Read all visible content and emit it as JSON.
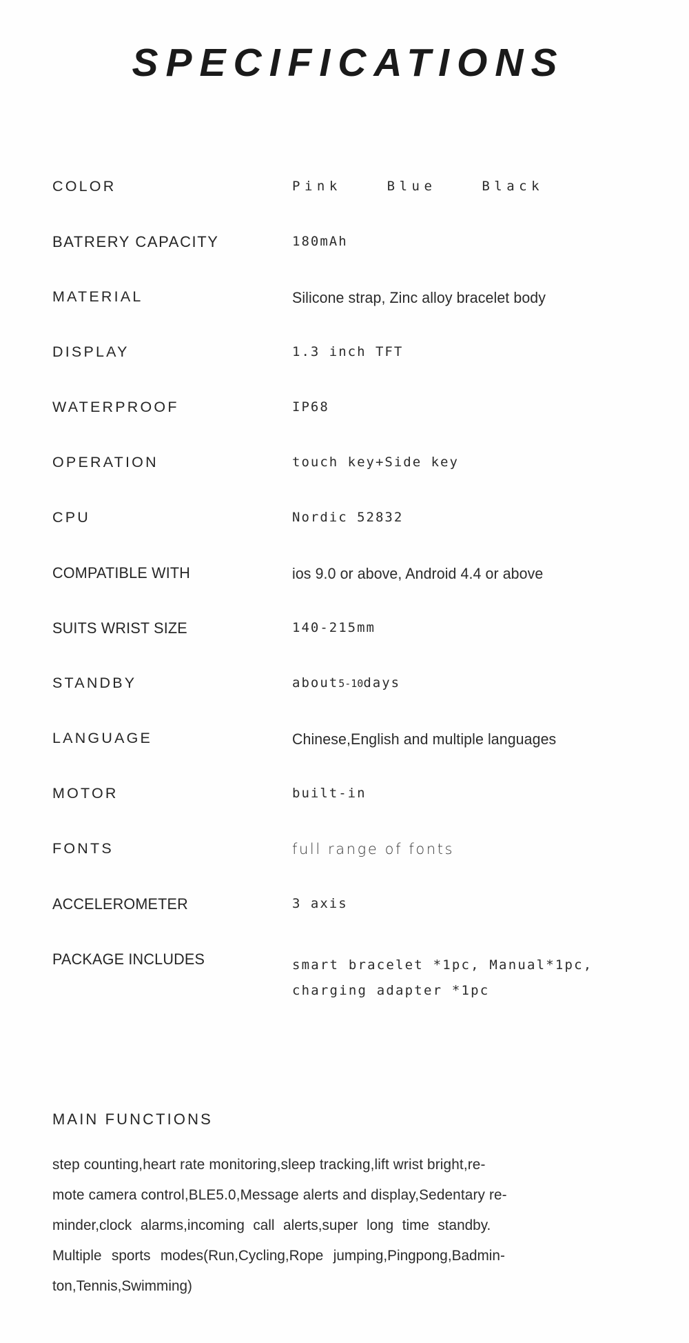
{
  "document": {
    "title": "SPECIFICATIONS"
  },
  "specs": {
    "rows": [
      {
        "label": "COLOR",
        "value": "Pink    Blue    Black",
        "colors": [
          "Pink",
          "Blue",
          "Black"
        ]
      },
      {
        "label": "BATRERY CAPACITY",
        "value": "180mAh"
      },
      {
        "label": "MATERIAL",
        "value": "Silicone strap, Zinc alloy bracelet body"
      },
      {
        "label": "DISPLAY",
        "value": "1.3 inch TFT"
      },
      {
        "label": "WATERPROOF",
        "value": "IP68"
      },
      {
        "label": "OPERATION",
        "value": "touch key+Side key"
      },
      {
        "label": "CPU",
        "value": "Nordic  52832"
      },
      {
        "label": "COMPATIBLE WITH",
        "value": "ios 9.0 or above, Android 4.4 or above"
      },
      {
        "label": "SUITS WRIST SIZE",
        "value": "140-215mm"
      },
      {
        "label": "STANDBY",
        "value": "about5-10days",
        "value_parts": {
          "prefix": "about",
          "range": "5-10",
          "suffix": "days"
        }
      },
      {
        "label": "LANGUAGE",
        "value": "Chinese,English and multiple languages"
      },
      {
        "label": "MOTOR",
        "value": "built-in"
      },
      {
        "label": "FONTS",
        "value": "full range of fonts"
      },
      {
        "label": "ACCELEROMETER",
        "value": "3 axis"
      },
      {
        "label": "PACKAGE INCLUDES",
        "value": "smart bracelet *1pc, Manual*1pc, charging adapter *1pc",
        "lines": [
          "smart bracelet *1pc, Manual*1pc,",
          "charging adapter *1pc"
        ]
      }
    ]
  },
  "main_functions": {
    "heading": "MAIN FUNCTIONS",
    "body": "step counting,heart rate monitoring,sleep tracking,lift wrist bright,remote camera control,BLE5.0,Message alerts and display,Sedentary reminder,clock alarms,incoming call alerts,super long time standby. Multiple sports modes(Run,Cycling,Rope jumping,Pingpong,Badminton,Tennis,Swimming)",
    "lines": [
      "step counting,heart rate monitoring,sleep tracking,lift wrist bright,re-",
      "mote camera control,BLE5.0,Message alerts and display,Sedentary re-",
      "minder,clock alarms,incoming call alerts,super long time standby.",
      "Multiple sports modes(Run,Cycling,Rope jumping,Pingpong,Badmin-",
      "ton,Tennis,Swimming)"
    ]
  },
  "colors": {
    "text": "#231f20",
    "background": "#ffffff",
    "heading": "#1a1a1a"
  }
}
